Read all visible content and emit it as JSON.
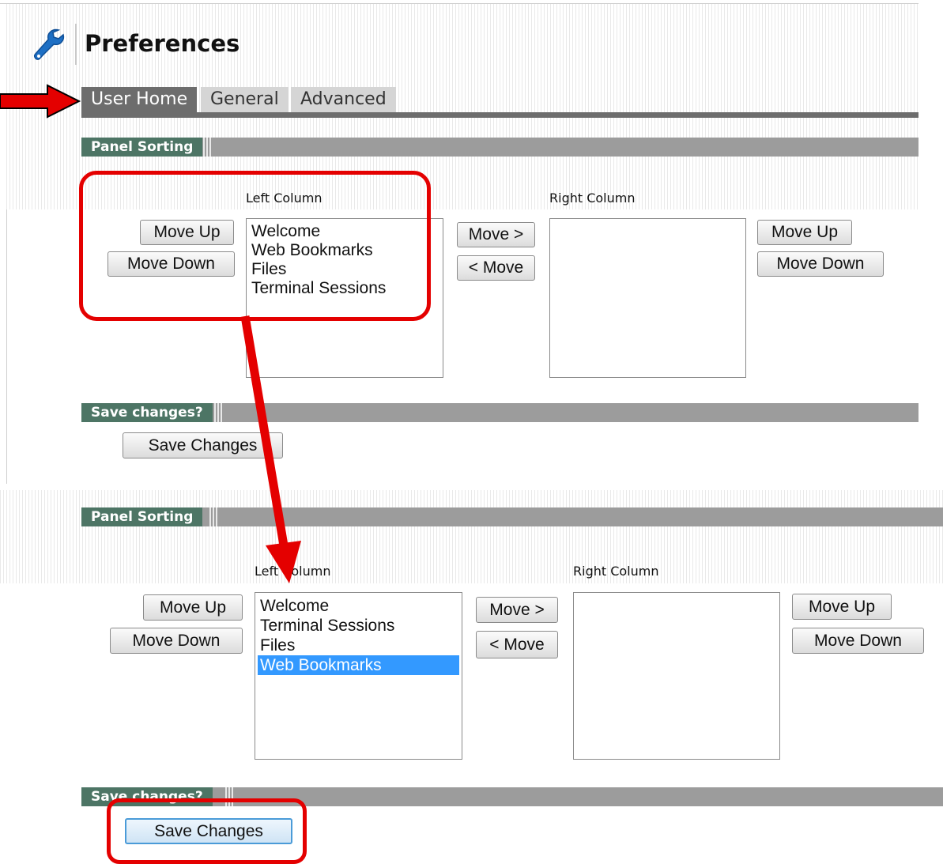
{
  "page_title": "Preferences",
  "tabs": [
    {
      "label": "User Home",
      "active": true
    },
    {
      "label": "General",
      "active": false
    },
    {
      "label": "Advanced",
      "active": false
    }
  ],
  "panel_sorting_label": "Panel Sorting",
  "save_section_label": "Save changes?",
  "left_column_label": "Left Column",
  "right_column_label": "Right Column",
  "move_up_label": "Move Up",
  "move_down_label": "Move Down",
  "move_right_label": "Move >",
  "move_left_label": "< Move",
  "save_button_label": "Save Changes",
  "before": {
    "left_items": [
      "Welcome",
      "Web Bookmarks",
      "Files",
      "Terminal Sessions"
    ]
  },
  "after": {
    "left_items": [
      "Welcome",
      "Terminal Sessions",
      "Files",
      "Web Bookmarks"
    ],
    "selected_item": "Web Bookmarks"
  },
  "icons": {
    "title_icon": "wrench-icon",
    "annotation_arrows": "red-arrow-icon"
  },
  "colors": {
    "section_label_bg": "#4d7565",
    "tab_active_bg": "#6d6d6d",
    "selection": "#3399ff",
    "annotation": "#e40000"
  }
}
